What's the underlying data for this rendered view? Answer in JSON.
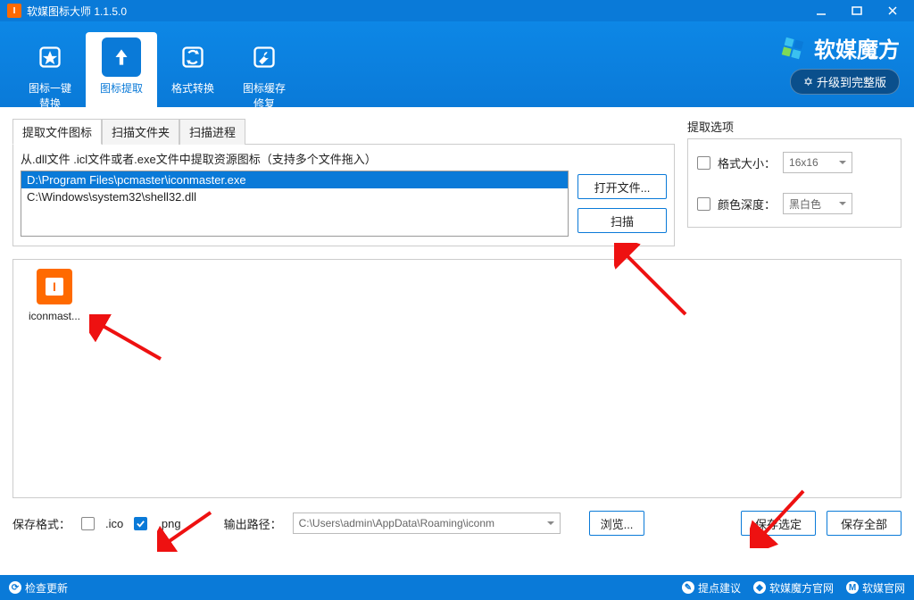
{
  "window": {
    "title": "软媒图标大师 1.1.5.0"
  },
  "toolbar": {
    "items": [
      {
        "label": "图标一键\n替换"
      },
      {
        "label": "图标提取"
      },
      {
        "label": "格式转换"
      },
      {
        "label": "图标缓存\n修复"
      }
    ]
  },
  "brand": {
    "name": "软媒魔方",
    "upgrade": "升级到完整版"
  },
  "tabs": {
    "items": [
      "提取文件图标",
      "扫描文件夹",
      "扫描进程"
    ]
  },
  "extract": {
    "hint": "从.dll文件 .icl文件或者.exe文件中提取资源图标（支持多个文件拖入）",
    "files": [
      "D:\\Program Files\\pcmaster\\iconmaster.exe",
      "C:\\Windows\\system32\\shell32.dll"
    ],
    "open": "打开文件...",
    "scan": "扫描"
  },
  "options": {
    "title": "提取选项",
    "size_label": "格式大小：",
    "size_value": "16x16",
    "depth_label": "颜色深度：",
    "depth_value": "黑白色"
  },
  "preview": {
    "icon_name": "iconmast..."
  },
  "save": {
    "format_label": "保存格式：",
    "ico": ".ico",
    "png": ".png",
    "path_label": "输出路径：",
    "path_value": "C:\\Users\\admin\\AppData\\Roaming\\iconm",
    "browse": "浏览...",
    "save_selected": "保存选定",
    "save_all": "保存全部"
  },
  "status": {
    "check_update": "检查更新",
    "suggest": "提点建议",
    "mofang_site": "软媒魔方官网",
    "ruanmei_site": "软媒官网"
  }
}
